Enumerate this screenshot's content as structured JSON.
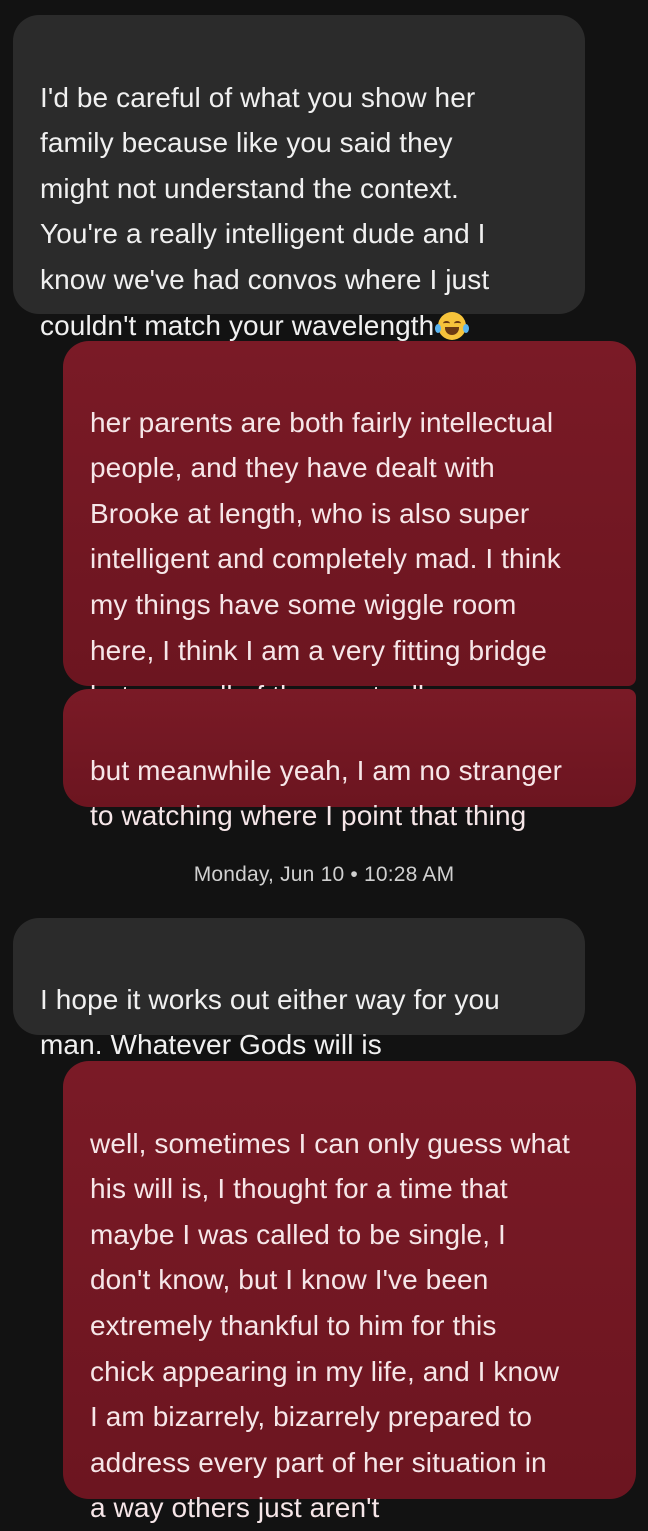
{
  "messages": [
    {
      "direction": "incoming",
      "text": "I'd be careful of what you show her\nfamily because like you said they\nmight not understand the context.\nYou're a really intelligent dude and I\nknow we've had convos where I just\ncouldn't match your wavelength",
      "emoji": "face-with-tears-of-joy"
    },
    {
      "direction": "outgoing",
      "text": "her parents are both fairly intellectual\npeople, and they have dealt with\nBrooke at length, who is also super\nintelligent and completely mad. I think\nmy things have some wiggle room\nhere, I think I am a very fitting bridge\nbetween all of them actually"
    },
    {
      "direction": "outgoing",
      "text": "but meanwhile yeah, I am no stranger\nto watching where I point that thing"
    },
    {
      "direction": "incoming",
      "text": "I hope it works out either way for you\nman. Whatever Gods will is"
    },
    {
      "direction": "outgoing",
      "text": "well, sometimes I can only guess what\nhis will is, I thought for a time that\nmaybe I was called to be single, I\ndon't know, but I know I've been\nextremely thankful to him for this\nchick appearing in my life, and I know\nI am bizarrely, bizarrely prepared to\naddress every part of her situation in\na way others just aren't"
    }
  ],
  "timestamp": "Monday, Jun 10 • 10:28 AM",
  "colors": {
    "background": "#121212",
    "incoming_bubble": "#2b2b2b",
    "outgoing_bubble": "#761a25",
    "text": "#ececec"
  }
}
